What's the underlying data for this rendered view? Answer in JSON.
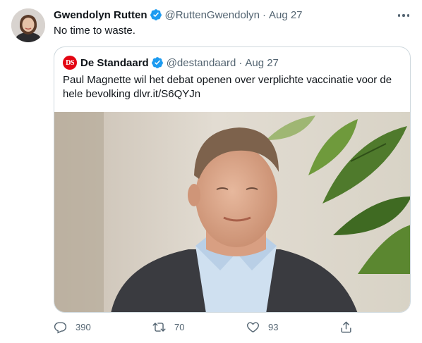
{
  "author": {
    "name": "Gwendolyn Rutten",
    "handle": "@RuttenGwendolyn",
    "separator": "·",
    "date": "Aug 27",
    "verified": true
  },
  "tweet": {
    "text": "No time to waste."
  },
  "quoted_tweet": {
    "logo_text": "DS",
    "name": "De Standaard",
    "handle": "@destandaard",
    "separator": "·",
    "date": "Aug 27",
    "verified": true,
    "text": "Paul Magnette wil het debat openen over verplichte vaccinatie voor de hele bevolking dlvr.it/S6QYJn",
    "image": "photo of a man in a suit and light blue shirt in front of a plant"
  },
  "actions": {
    "reply_count": "390",
    "retweet_count": "70",
    "like_count": "93"
  },
  "icons": {
    "verified": "verified-badge-icon",
    "more": "more-icon",
    "reply": "reply-icon",
    "retweet": "retweet-icon",
    "like": "like-icon",
    "share": "share-icon"
  },
  "colors": {
    "verified_blue": "#1d9bf0",
    "secondary_text": "#536471",
    "border": "#cfd9de",
    "ds_red": "#e30613"
  }
}
